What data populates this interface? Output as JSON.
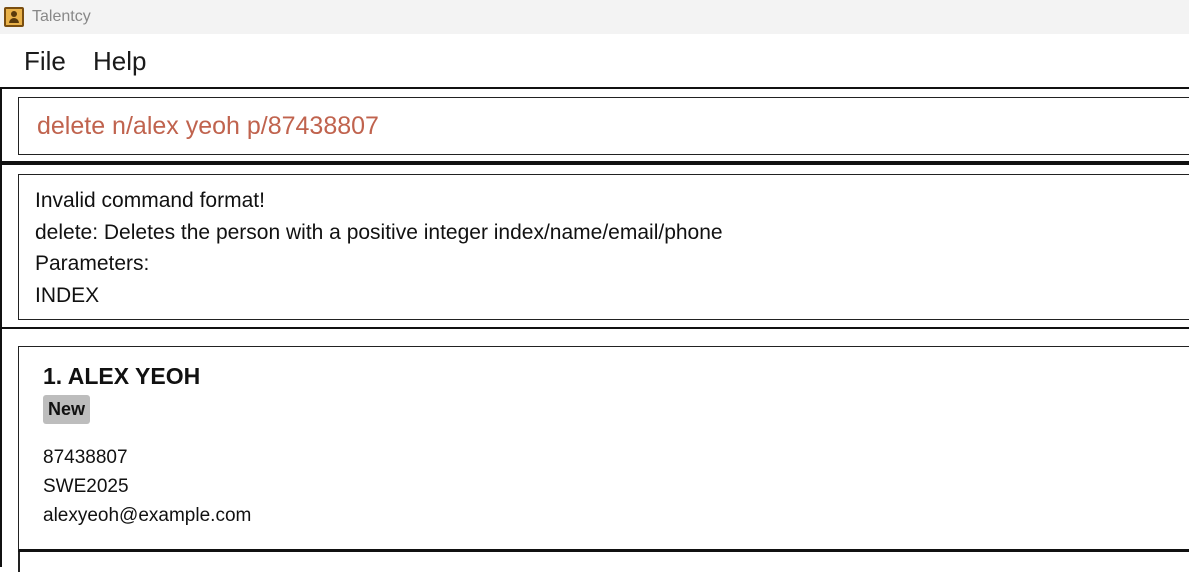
{
  "window": {
    "title": "Talentcy",
    "icon": "address-book-icon"
  },
  "menu": {
    "items": [
      "File",
      "Help"
    ]
  },
  "command": {
    "value": "delete n/alex yeoh p/87438807",
    "color": "#c0634e"
  },
  "result": {
    "lines": [
      "Invalid command format!",
      "delete: Deletes the person with a positive integer index/name/email/phone",
      "Parameters:",
      "INDEX"
    ]
  },
  "persons": [
    {
      "title": "1. ALEX YEOH",
      "tag": "New",
      "phone": "87438807",
      "job": "SWE2025",
      "email": "alexyeoh@example.com"
    }
  ]
}
